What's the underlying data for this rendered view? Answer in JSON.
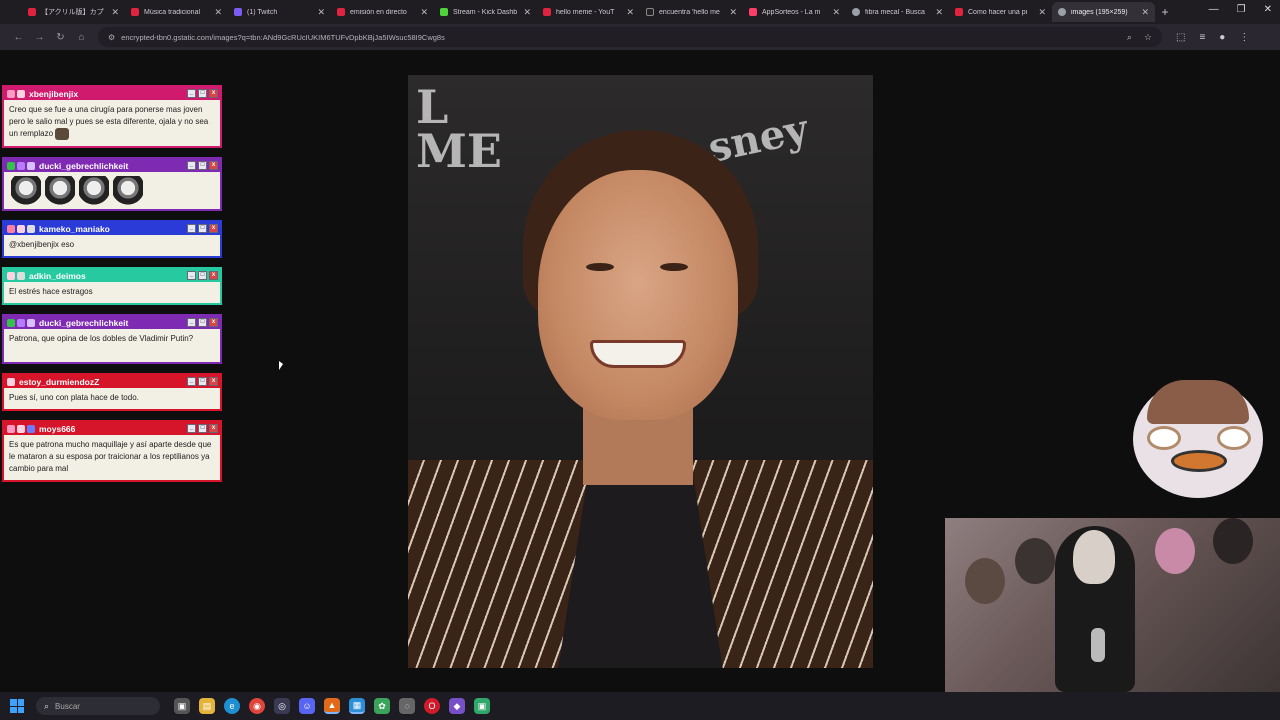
{
  "browser": {
    "tabs": [
      {
        "title": "【アクリル版】カプ",
        "color": "#e0233f"
      },
      {
        "title": "Música tradicional",
        "color": "#e0233f"
      },
      {
        "title": "(1) Twitch",
        "color": "#7b5cf0"
      },
      {
        "title": "emisión en directo",
        "color": "#e0233f"
      },
      {
        "title": "Stream - Kick Dashb",
        "color": "#4fd33a"
      },
      {
        "title": "hello meme - YouT",
        "color": "#e0233f"
      },
      {
        "title": "encuentra 'hello me",
        "color": "#222222"
      },
      {
        "title": "AppSorteos - La m",
        "color": "#ff3d6a"
      },
      {
        "title": "fibra mecal - Busca",
        "color": "#9aa0a6"
      },
      {
        "title": "Como hacer una pi",
        "color": "#e0233f"
      },
      {
        "title": "images (195×259)",
        "color": "#9aa0a6",
        "active": true
      }
    ],
    "new_tab": "+",
    "url": "encrypted-tbn0.gstatic.com/images?q=tbn:ANd9GcRUcIUKIM6TUFvDpbKBjJa5IWsuc58I9Cwg8s"
  },
  "chat": {
    "messages": [
      {
        "user": "xbenjibenjix",
        "color": "#d01a6d",
        "text": "Creo que se fue a una cirugía para ponerse mas joven pero le salio mal y pues se esta diferente, ojala y no sea un remplazo"
      },
      {
        "user": "ducki_gebrechlichkeit",
        "color": "#7f2ab3",
        "text": ""
      },
      {
        "user": "kameko_maniako",
        "color": "#2a3bd8",
        "text": "@xbenjibenjix eso"
      },
      {
        "user": "adkin_deimos",
        "color": "#27c9a0",
        "text": "El estrés hace estragos"
      },
      {
        "user": "ducki_gebrechlichkeit",
        "color": "#7f2ab3",
        "text": "Patrona, que opina de los dobles de Vladimir Putin?"
      },
      {
        "user": "estoy_durmiendozZ",
        "color": "#d6152b",
        "text": "Pues sí, uno con plata hace de todo."
      },
      {
        "user": "moys666",
        "color": "#d6152b",
        "text": "Es que patrona mucho maquillaje y así aparte desde que le mataron a su esposa por traicionar a los reptilianos ya cambio para mal"
      }
    ]
  },
  "taskbar": {
    "search_placeholder": "Buscar"
  }
}
